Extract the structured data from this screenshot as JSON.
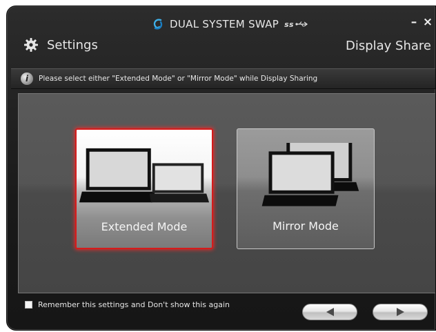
{
  "window": {
    "title": "DUAL SYSTEM SWAP",
    "usb_badge": "ss",
    "minimize_label": "–",
    "close_label": "×"
  },
  "header": {
    "settings_label": "Settings",
    "section_title": "Display Share"
  },
  "info": {
    "icon_glyph": "i",
    "message": "Please select either \"Extended Mode\" or \"Mirror Mode\" while Display Sharing"
  },
  "modes": [
    {
      "label": "Extended Mode",
      "selected": true
    },
    {
      "label": "Mirror Mode",
      "selected": false
    }
  ],
  "footer": {
    "remember_label": "Remember this settings and Don't show this again",
    "remember_checked": false
  },
  "colors": {
    "accent_selected": "#d61a1a",
    "background": "#1e1e1e"
  }
}
